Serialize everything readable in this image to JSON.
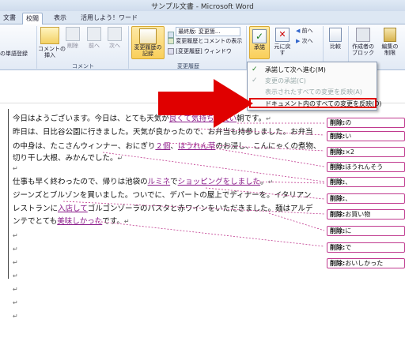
{
  "window": {
    "title": "サンプル文書 - Microsoft Word"
  },
  "tabs": [
    {
      "label": "文書",
      "active": false
    },
    {
      "label": "校閲",
      "active": true
    },
    {
      "label": "表示",
      "active": false
    },
    {
      "label": "活用しよう！ワード",
      "active": false
    }
  ],
  "ribbon": {
    "word_register_label": "の単語登録",
    "comment_group": {
      "label": "コメント",
      "insert_comment": "コメントの\n挿入",
      "delete": "削除",
      "previous": "前へ",
      "next": "次へ"
    },
    "tracking_group": {
      "label": "変更履歴",
      "track_changes": "変更履歴の\n記録",
      "display_mode": "最終版: 変更箇...",
      "show_markup": "変更履歴とコメントの表示",
      "reviewing_pane": "[変更履歴] ウィンドウ"
    },
    "changes_group": {
      "accept": "承諾",
      "reject": "元に戻す",
      "previous": "前へ",
      "next": "次へ"
    },
    "compare_group": {
      "compare": "比較"
    },
    "protect_group": {
      "block_authors": "作成者の\nブロック",
      "restrict_editing": "編集の\n制限"
    }
  },
  "accept_menu": {
    "items": [
      {
        "label": "承諾して次へ進む(M)",
        "enabled": true
      },
      {
        "label": "変更の承諾(C)",
        "enabled": false
      },
      {
        "label": "表示されたすべての変更を反映(A)",
        "enabled": false
      },
      {
        "label": "ドキュメント内のすべての変更を反映(D)",
        "enabled": true,
        "highlighted": true
      }
    ]
  },
  "document": {
    "para1": [
      [
        {
          "t": "今日はようございます。今日は、とても天気が"
        },
        {
          "t": "良くて気持ちの良い",
          "ins": true
        },
        {
          "t": "朝です。"
        },
        {
          "t": "↵",
          "pm": true
        }
      ],
      [
        {
          "t": "昨日は、日比谷公園に行きました。天気が良かったので、お弁当も持参しました。お弁当"
        }
      ],
      [
        {
          "t": "の中身は、たこさんウィンナー、おにぎり"
        },
        {
          "t": "２個",
          "ins": true
        },
        {
          "t": "、"
        },
        {
          "t": "ほうれん草",
          "ins": true
        },
        {
          "t": "のお浸し、こんにゃくの煮物、"
        }
      ],
      [
        {
          "t": "切り干し大根、みかんでした。"
        },
        {
          "t": "↵",
          "pm": true
        }
      ]
    ],
    "para2": [
      [
        {
          "t": "仕事も早く終わったので、帰りは池袋の"
        },
        {
          "t": "ルミネ",
          "ins": true
        },
        {
          "t": "で"
        },
        {
          "t": "ショッピングをしました",
          "ins": true
        },
        {
          "t": "。"
        },
        {
          "t": "↵",
          "pm": true
        }
      ],
      [
        {
          "t": "ジーンズとブルゾンを買いました。ついでに、デパートの屋上でディナーを。イタリアン"
        }
      ],
      [
        {
          "t": "レストランに"
        },
        {
          "t": "入店して",
          "ins": true
        },
        {
          "t": "ゴルゴンゾーラのパスタと赤ワインをいただきました。麺はアルデ"
        }
      ],
      [
        {
          "t": "ンテでとても"
        },
        {
          "t": "美味しかった",
          "ins": true
        },
        {
          "t": "です。"
        },
        {
          "t": "↵",
          "pm": true
        }
      ]
    ],
    "empty_marks": [
      "↵",
      "↵",
      "↵",
      "↵",
      "↵",
      "↵",
      "↵",
      "↵"
    ]
  },
  "balloons": [
    {
      "type": "削除:",
      "text": "の"
    },
    {
      "type": "削除:",
      "text": "い"
    },
    {
      "type": "削除:",
      "text": "×2"
    },
    {
      "type": "削除:",
      "text": "ほうれんそう"
    },
    {
      "type": "削除:",
      "text": "、"
    },
    {
      "type": "削除:",
      "text": "、"
    },
    {
      "type": "削除:",
      "text": "お買い物"
    },
    {
      "type": "削除:",
      "text": "に"
    },
    {
      "type": "削除:",
      "text": "で"
    },
    {
      "type": "削除:",
      "text": "おいしかった"
    }
  ],
  "colors": {
    "accent": "#e00000",
    "insertion": "#8a1c8a",
    "balloon_border": "#c03a8f"
  }
}
